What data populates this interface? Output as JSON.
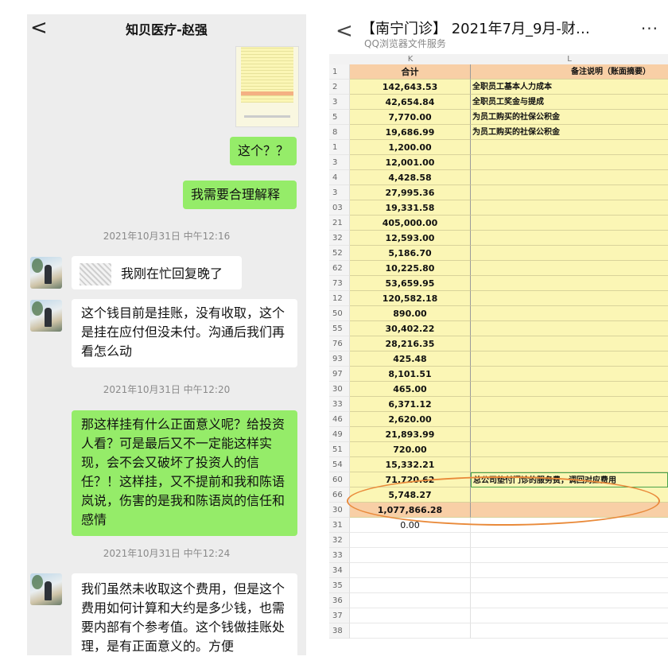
{
  "chat": {
    "back_glyph": "<",
    "title": "知贝医疗-赵强",
    "messages": {
      "m1": "这个？？",
      "m2": "我需要合理解释",
      "t1": "2021年10月31日 中午12:16",
      "m3": "我刚在忙回复晚了",
      "m4": "这个钱目前是挂账，没有收取，这个是挂在应付但没未付。沟通后我们再看怎么动",
      "t2": "2021年10月31日 中午12:20",
      "m5": "那这样挂有什么正面意义呢？给投资人看？可是最后又不一定能这样实现，会不会又破坏了投资人的信任？！这样挂，又不提前和我和陈语岚说，伤害的是我和陈语岚的信任和感情",
      "t3": "2021年10月31日 中午12:24",
      "m6": "我们虽然未收取这个费用，但是这个费用如何计算和大约是多少钱，也需要内部有个参考值。这个钱做挂账处理，是有正面意义的。方便"
    }
  },
  "sheet": {
    "back_glyph": "<",
    "title": "【南宁门诊】 2021年7月_9月-财…",
    "subtitle": "QQ浏览器文件服务",
    "more_glyph": "···",
    "col_k": "K",
    "col_l": "L",
    "header": {
      "row": "1",
      "k": "合计",
      "l": "备注说明（账面摘要）"
    },
    "rows": [
      {
        "row": "2",
        "k": "142,643.53",
        "l": "全职员工基本人力成本"
      },
      {
        "row": "3",
        "k": "42,654.84",
        "l": "全职员工奖金与提成"
      },
      {
        "row": "5",
        "k": "7,770.00",
        "l": "为员工购买的社保公积金"
      },
      {
        "row": "8",
        "k": "19,686.99",
        "l": "为员工购买的社保公积金"
      },
      {
        "row": "1",
        "k": "1,200.00",
        "l": ""
      },
      {
        "row": "3",
        "k": "12,001.00",
        "l": ""
      },
      {
        "row": "4",
        "k": "4,428.58",
        "l": ""
      },
      {
        "row": "3",
        "k": "27,995.36",
        "l": ""
      },
      {
        "row": "03",
        "k": "19,331.58",
        "l": ""
      },
      {
        "row": "21",
        "k": "405,000.00",
        "l": ""
      },
      {
        "row": "32",
        "k": "12,593.00",
        "l": ""
      },
      {
        "row": "52",
        "k": "5,186.70",
        "l": ""
      },
      {
        "row": "62",
        "k": "10,225.80",
        "l": ""
      },
      {
        "row": "73",
        "k": "53,659.95",
        "l": ""
      },
      {
        "row": "12",
        "k": "120,582.18",
        "l": ""
      },
      {
        "row": "50",
        "k": "890.00",
        "l": ""
      },
      {
        "row": "55",
        "k": "30,402.22",
        "l": ""
      },
      {
        "row": "76",
        "k": "28,216.35",
        "l": ""
      },
      {
        "row": "93",
        "k": "425.48",
        "l": ""
      },
      {
        "row": "97",
        "k": "8,101.51",
        "l": ""
      },
      {
        "row": "30",
        "k": "465.00",
        "l": ""
      },
      {
        "row": "33",
        "k": "6,371.12",
        "l": ""
      },
      {
        "row": "46",
        "k": "2,620.00",
        "l": ""
      },
      {
        "row": "49",
        "k": "21,893.99",
        "l": ""
      },
      {
        "row": "51",
        "k": "720.00",
        "l": ""
      },
      {
        "row": "54",
        "k": "15,332.21",
        "l": ""
      },
      {
        "row": "60",
        "k": "71,720.62",
        "l": "总公司垫付门诊的服务费，调回对应费用"
      },
      {
        "row": "66",
        "k": "5,748.27",
        "l": ""
      },
      {
        "row": "30",
        "k": "1,077,866.28",
        "l": ""
      },
      {
        "row": "31",
        "k": "0.00",
        "l": ""
      },
      {
        "row": "32",
        "k": "",
        "l": ""
      },
      {
        "row": "33",
        "k": "",
        "l": ""
      },
      {
        "row": "34",
        "k": "",
        "l": ""
      },
      {
        "row": "35",
        "k": "",
        "l": ""
      },
      {
        "row": "36",
        "k": "",
        "l": ""
      },
      {
        "row": "37",
        "k": "",
        "l": ""
      },
      {
        "row": "38",
        "k": "",
        "l": ""
      }
    ]
  },
  "colors": {
    "chat_bg": "#ededed",
    "my_bubble": "#95ec69",
    "sheet_yellow": "#fbf6b5",
    "sheet_orange": "#f8cfa6",
    "circle": "#e98a3a"
  }
}
